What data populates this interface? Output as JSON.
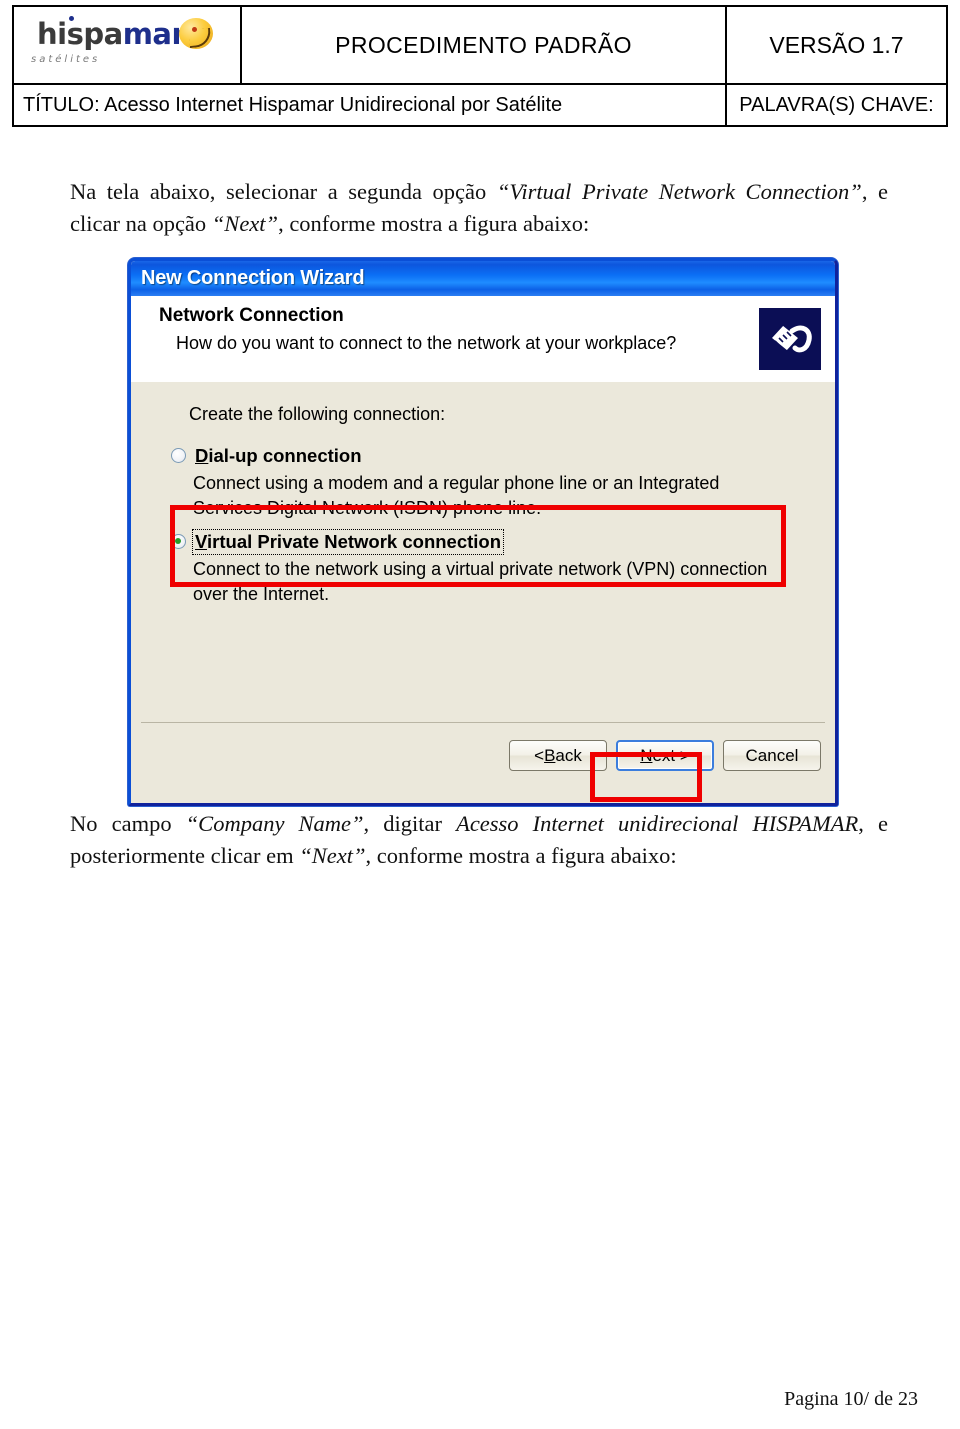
{
  "header": {
    "logo": {
      "name_part1": "hispa",
      "name_part2": "mar",
      "tagline": "satélites"
    },
    "document_type": "PROCEDIMENTO PADRÃO",
    "version": "VERSÃO 1.7",
    "title": "TÍTULO: Acesso Internet Hispamar Unidirecional por Satélite",
    "keywords_label": "PALAVRA(S) CHAVE:"
  },
  "body": {
    "paragraph_top_html": "Na tela abaixo, selecionar a segunda opção <i>“Virtual Private Network Connection”</i>, e clicar na opção <i>“Next”</i>, conforme mostra a figura abaixo:",
    "paragraph_bottom_html": "No campo <i>“Company Name”</i>, digitar <i>Acesso Internet unidirecional HISPAMAR</i>, e posteriormente clicar em <i>“Next”</i>, conforme mostra a figura abaixo:"
  },
  "wizard": {
    "window_title": "New Connection Wizard",
    "page_heading": "Network Connection",
    "page_subheading": "How do you want to connect to the network at your workplace?",
    "icon_name": "network-plug-icon",
    "lead_text": "Create the following connection:",
    "options": [
      {
        "id": "dial-up",
        "title": "Dial-up connection",
        "accelerator": "D",
        "description": "Connect using a modem and a regular phone line or an Integrated Services Digital Network (ISDN) phone line.",
        "selected": false,
        "focused": false,
        "highlighted": false
      },
      {
        "id": "vpn",
        "title": "Virtual Private Network connection",
        "accelerator": "V",
        "description": "Connect to the network using a virtual private network (VPN) connection over the Internet.",
        "selected": true,
        "focused": true,
        "highlighted": true
      }
    ],
    "buttons": [
      {
        "id": "back",
        "label": "< Back",
        "accelerator": "B",
        "default": false,
        "highlighted": false
      },
      {
        "id": "next",
        "label": "Next >",
        "accelerator": "N",
        "default": true,
        "highlighted": true
      },
      {
        "id": "cancel",
        "label": "Cancel",
        "accelerator": "",
        "default": false,
        "highlighted": false
      }
    ]
  },
  "annotations": {
    "color": "#ef0000",
    "vpn_box_label": "red-highlight-vpn-option",
    "next_box_label": "red-highlight-next-button"
  },
  "footer": {
    "page_text": "Pagina 10/ de 23"
  }
}
